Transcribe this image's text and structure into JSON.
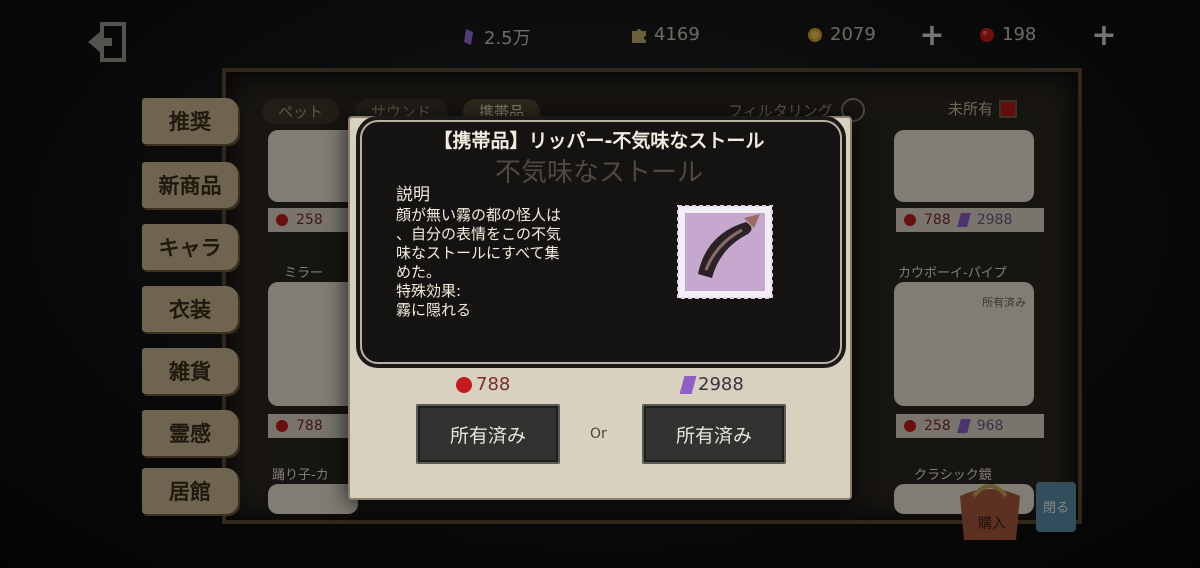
{
  "topbar": {
    "back_icon": "exit-door-icon",
    "currencies": [
      {
        "icon": "purple-crystal-icon",
        "value": "2.5万"
      },
      {
        "icon": "puzzle-piece-icon",
        "value": "4169"
      },
      {
        "icon": "gold-clue-icon",
        "value": "2079"
      },
      {
        "icon": "red-echo-icon",
        "value": "198"
      }
    ]
  },
  "shop": {
    "tabs": [
      "ペット",
      "サウンド",
      "携帯品"
    ],
    "active_tab": "携帯品",
    "filter_label": "フィルタリング",
    "unowned_label": "未所有",
    "categories": [
      "推奨",
      "新商品",
      "キャラ",
      "衣装",
      "雑貨",
      "霊感",
      "居館"
    ],
    "cards": [
      {
        "title": "",
        "price_red": "258",
        "price_purple": ""
      },
      {
        "title": "",
        "price_red": "788",
        "price_purple": "2988"
      },
      {
        "title": "ミラー",
        "price_red": "788",
        "price_purple": ""
      },
      {
        "title": "カウボーイ-パイプ",
        "badge": "所有済み",
        "price_red": "258",
        "price_purple": "968"
      },
      {
        "title": "踊り子-カ",
        "price_red": "",
        "price_purple": ""
      },
      {
        "title": "クラシック鏡",
        "price_red": "",
        "price_purple": ""
      }
    ],
    "bag_label": "購入",
    "close_label": "閉る"
  },
  "dialog": {
    "title": "【携帯品】リッパー-不気味なストール",
    "ghost_name": "不気味なストール",
    "desc_heading": "説明",
    "desc_text": "顔が無い霧の都の怪人は\n、自分の表情をこの不気\n味なストールにすべて集\nめた。\n特殊効果:\n霧に隠れる",
    "price_red": "788",
    "price_purple": "2988",
    "button_left": "所有済み",
    "or_text": "Or",
    "button_right": "所有済み"
  },
  "colors": {
    "red_currency": "#c41b1b",
    "purple_currency": "#8e5fc7",
    "panel_bg": "#141312"
  }
}
